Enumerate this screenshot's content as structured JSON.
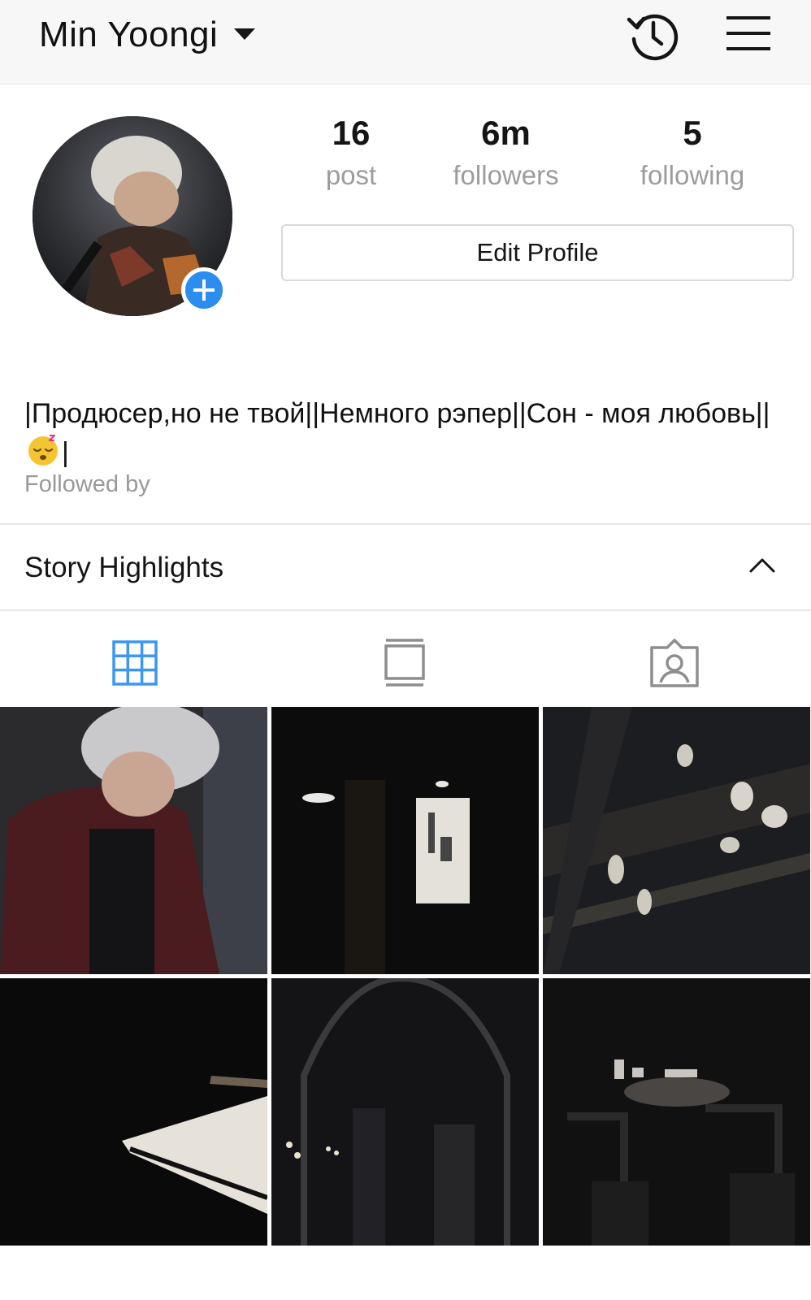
{
  "header": {
    "username": "Min Yoongi"
  },
  "stats": {
    "posts": {
      "value": "16",
      "label": "post"
    },
    "followers": {
      "value": "6m",
      "label": "followers"
    },
    "following": {
      "value": "5",
      "label": "following"
    }
  },
  "actions": {
    "edit_profile_label": "Edit Profile"
  },
  "bio": {
    "text_before_emoji": "|Продюсер,но не твой||Немного рэпер||Сон - моя любовь||",
    "emoji": "sleeping-face",
    "text_after_emoji": "|",
    "followed_by": "Followed by"
  },
  "highlights": {
    "title": "Story Highlights",
    "expanded": true
  },
  "tabs": [
    {
      "name": "grid",
      "icon": "grid-icon",
      "active": true
    },
    {
      "name": "igtv",
      "icon": "igtv-icon",
      "active": false
    },
    {
      "name": "tagged",
      "icon": "tagged-icon",
      "active": false
    }
  ],
  "posts": [
    {
      "description": "person with silver hair in dark red coat"
    },
    {
      "description": "dark hallway with lit sign"
    },
    {
      "description": "magnolia blossoms at night"
    },
    {
      "description": "piano keys in darkness"
    },
    {
      "description": "gothic church interior"
    },
    {
      "description": "dim restaurant table and chairs"
    }
  ],
  "colors": {
    "accent_blue": "#2c8df0",
    "active_tab": "#3b97f2",
    "inactive_icon": "#8e8e8e",
    "muted_text": "#9c9c9c"
  }
}
